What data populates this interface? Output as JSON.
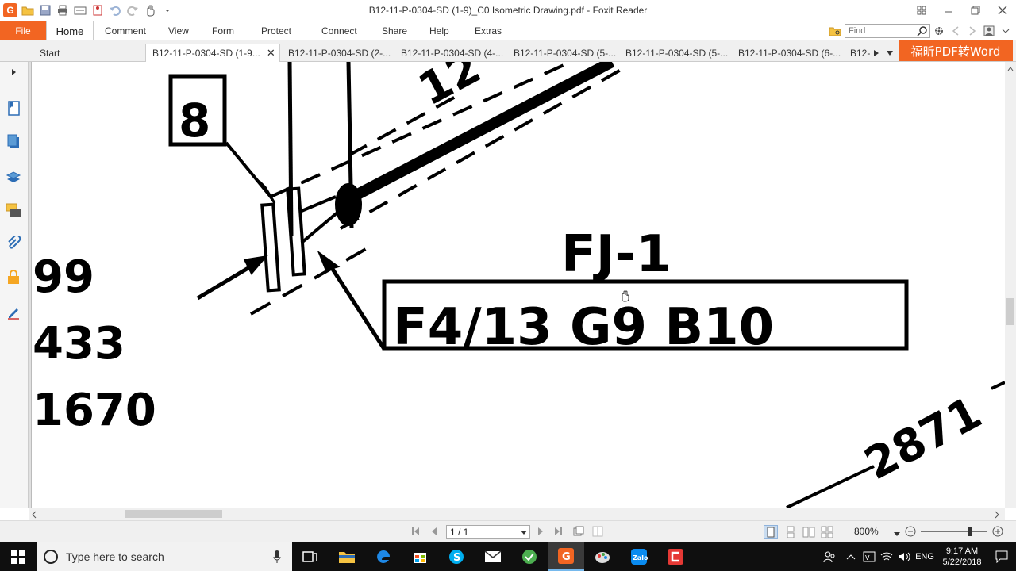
{
  "window": {
    "title": "B12-11-P-0304-SD (1-9)_C0 Isometric Drawing.pdf - Foxit Reader"
  },
  "ribbon": {
    "file_label": "File",
    "tabs": [
      "Home",
      "Comment",
      "View",
      "Form",
      "Protect",
      "Connect",
      "Share",
      "Help",
      "Extras"
    ],
    "find_placeholder": "Find"
  },
  "doc_tabs": {
    "start_label": "Start",
    "tabs": [
      "B12-11-P-0304-SD (1-9...",
      "B12-11-P-0304-SD (2-...",
      "B12-11-P-0304-SD (4-...",
      "B12-11-P-0304-SD (5-...",
      "B12-11-P-0304-SD (5-...",
      "B12-11-P-0304-SD (6-...",
      "B12-"
    ],
    "convert_label": "福昕PDF转Word"
  },
  "drawing": {
    "labels": {
      "box_num": "8",
      "fj": "FJ-1",
      "code": "F4/13 G9 B10",
      "n99": "99",
      "n433": "433",
      "n1670": "1670",
      "n2871": "2871",
      "n12": "12"
    }
  },
  "status": {
    "page": "1 / 1",
    "zoom": "800%"
  },
  "taskbar": {
    "search_placeholder": "Type here to search",
    "lang": "ENG",
    "time": "9:17 AM",
    "date": "5/22/2018"
  },
  "colors": {
    "accent": "#f26522",
    "taskbar": "#0f0f0f"
  }
}
